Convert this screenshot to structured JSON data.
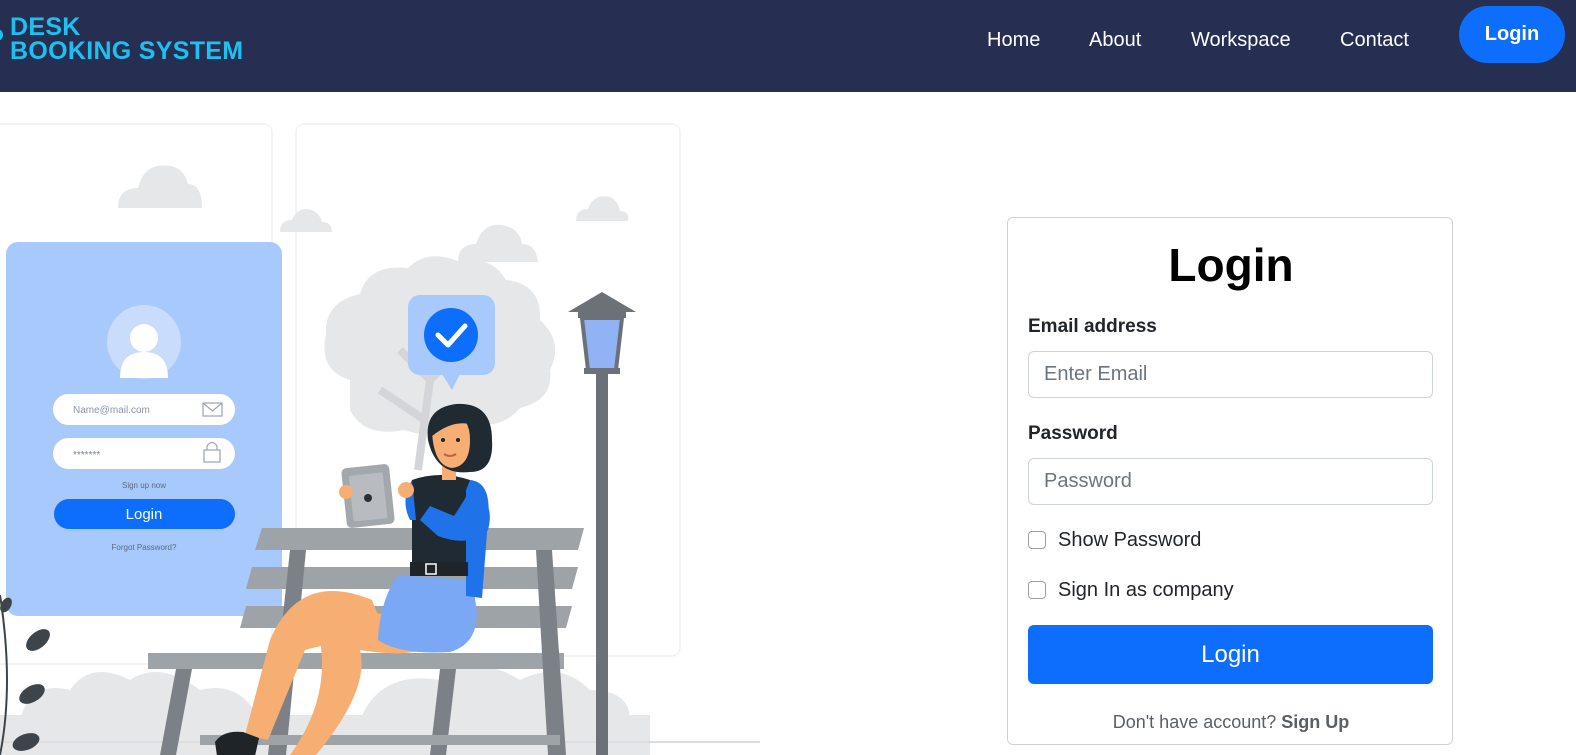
{
  "brand": {
    "line1": "DESK",
    "line2": "BOOKING SYSTEM"
  },
  "nav": {
    "links": [
      "Home",
      "About",
      "Workspace",
      "Contact"
    ],
    "login_label": "Login"
  },
  "illustration": {
    "email_placeholder": "Name@mail.com",
    "password_mask": "*******",
    "signup_text": "Sign up now",
    "login_label": "Login",
    "forgot_text": "Forgot Password?"
  },
  "form": {
    "title": "Login",
    "email_label": "Email address",
    "email_placeholder": "Enter Email",
    "password_label": "Password",
    "password_placeholder": "Password",
    "show_password_label": "Show Password",
    "company_label": "Sign In as company",
    "submit_label": "Login",
    "no_account_text": "Don't have account?",
    "signup_label": "Sign Up"
  },
  "colors": {
    "navbar": "#262f52",
    "brand": "#1ec0f0",
    "primary": "#0d6efd",
    "illus_panel": "#a7c9fb"
  }
}
